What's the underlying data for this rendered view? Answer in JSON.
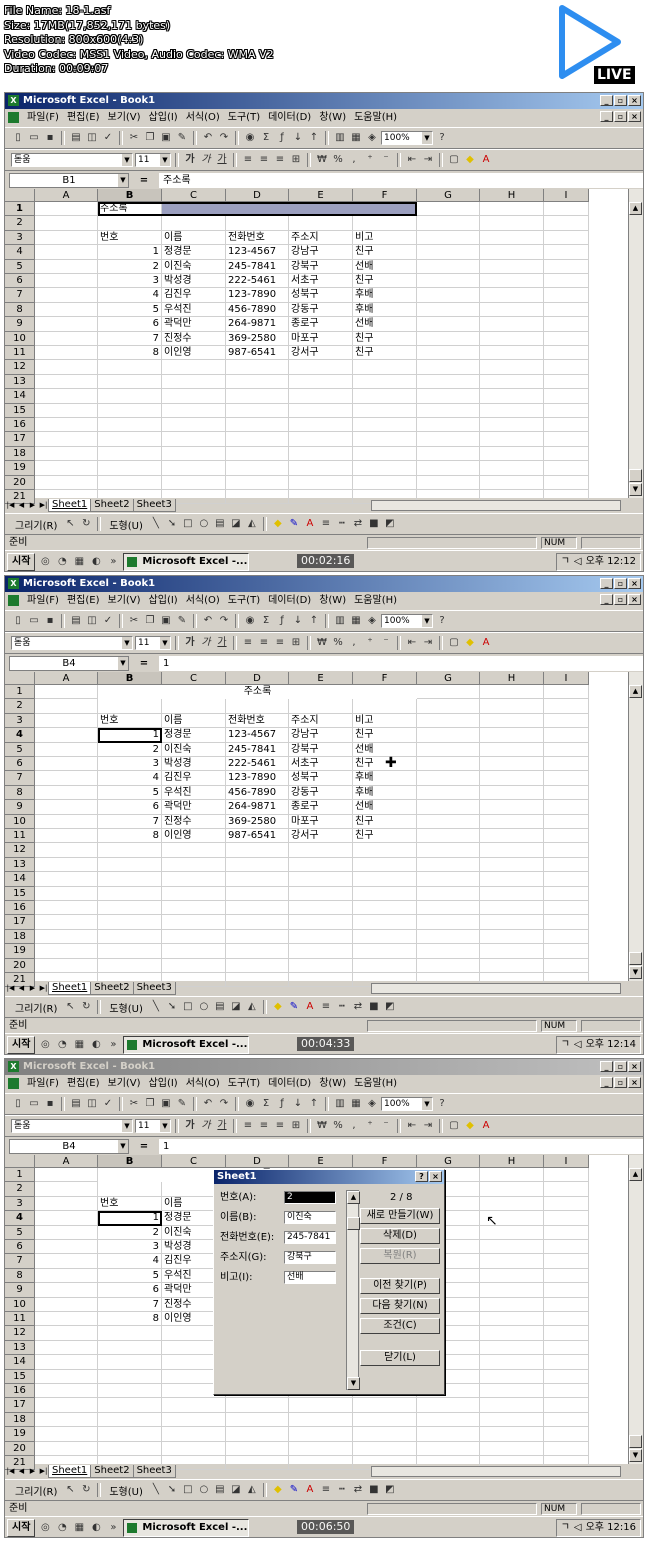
{
  "video_info": [
    "File Name: 18-1.asf",
    "Size: 17MB(17,852,171 bytes)",
    "Resolution: 800x600(4:3)",
    "Video Codec: MSS1 Video, Audio Codec: WMA V2",
    "Duration: 00:09:07"
  ],
  "live_label": "LIVE",
  "app": {
    "title": "Microsoft Excel - Book1",
    "menu": [
      "파일(F)",
      "편집(E)",
      "보기(V)",
      "삽입(I)",
      "서식(O)",
      "도구(T)",
      "데이터(D)",
      "창(W)",
      "도움말(H)"
    ],
    "zoom": "100%",
    "font_name": "돋움",
    "font_size": "11",
    "format_glyphs": [
      "가",
      "가",
      "가",
      "₩",
      "%",
      ","
    ],
    "columns": [
      "A",
      "B",
      "C",
      "D",
      "E",
      "F",
      "G",
      "H",
      "I"
    ],
    "sheets": [
      "Sheet1",
      "Sheet2",
      "Sheet3"
    ],
    "status_ready": "준비",
    "status_num": "NUM",
    "draw_label": "그리기(R)",
    "shapes_label": "도형(U)",
    "start_label": "시작",
    "task_label": "Microsoft Excel -..."
  },
  "sheet": {
    "title": "주소록",
    "headers": [
      "번호",
      "이름",
      "전화번호",
      "주소지",
      "비고"
    ],
    "records": [
      {
        "no": "1",
        "name": "정경문",
        "phone": "123-4567",
        "addr": "강남구",
        "note": "친구"
      },
      {
        "no": "2",
        "name": "이진숙",
        "phone": "245-7841",
        "addr": "강북구",
        "note": "선배"
      },
      {
        "no": "3",
        "name": "박성경",
        "phone": "222-5461",
        "addr": "서초구",
        "note": "친구"
      },
      {
        "no": "4",
        "name": "김진우",
        "phone": "123-7890",
        "addr": "성북구",
        "note": "후배"
      },
      {
        "no": "5",
        "name": "우석진",
        "phone": "456-7890",
        "addr": "강동구",
        "note": "후배"
      },
      {
        "no": "6",
        "name": "곽덕만",
        "phone": "264-9871",
        "addr": "종로구",
        "note": "선배"
      },
      {
        "no": "7",
        "name": "진정수",
        "phone": "369-2580",
        "addr": "마포구",
        "note": "친구"
      },
      {
        "no": "8",
        "name": "이인영",
        "phone": "987-6541",
        "addr": "강서구",
        "note": "친구"
      }
    ]
  },
  "frames": [
    {
      "namebox": "B1",
      "formula": "주소록",
      "time": "00:02:16",
      "clock": "오후 12:12",
      "active_col": 1,
      "active_row": 1
    },
    {
      "namebox": "B4",
      "formula": "1",
      "time": "00:04:33",
      "clock": "오후 12:14",
      "active_col": 1,
      "active_row": 4
    },
    {
      "namebox": "B4",
      "formula": "1",
      "time": "00:06:50",
      "clock": "오후 12:16",
      "active_col": 1,
      "active_row": 4
    }
  ],
  "dialog": {
    "title": "Sheet1",
    "record_pos": "2 / 8",
    "fields": [
      {
        "label": "번호(A):",
        "value": "2"
      },
      {
        "label": "이름(B):",
        "value": "이진숙"
      },
      {
        "label": "전화번호(E):",
        "value": "245-7841"
      },
      {
        "label": "주소지(G):",
        "value": "강북구"
      },
      {
        "label": "비고(I):",
        "value": "선배"
      }
    ],
    "buttons": [
      "새로 만들기(W)",
      "삭제(D)",
      "복원(R)",
      "이전 찾기(P)",
      "다음 찾기(N)",
      "조건(C)",
      "닫기(L)"
    ]
  }
}
